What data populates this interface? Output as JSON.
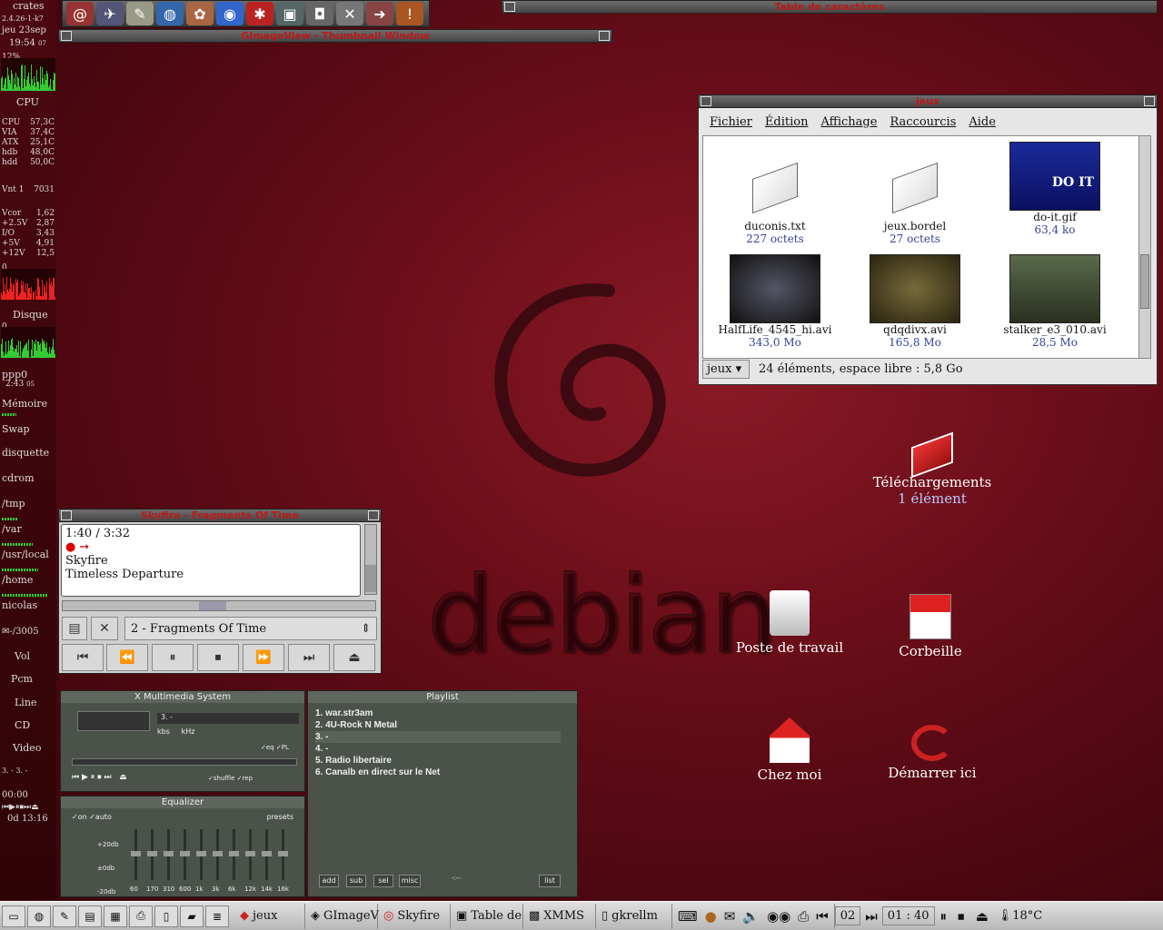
{
  "gkrellm": {
    "host": "crates",
    "kernel": "2.4.26-1-k7",
    "date": "jeu 23sep",
    "time": "19:54",
    "secs": "07",
    "cpu_pct": "12%",
    "cpu_label": "CPU",
    "sensors": [
      [
        "CPU",
        "57,3C"
      ],
      [
        "VIA",
        "37,4C"
      ],
      [
        "ATX",
        "25,1C"
      ],
      [
        "hdb",
        "48,0C"
      ],
      [
        "hdd",
        "50,0C"
      ]
    ],
    "fan": [
      "Vnt 1",
      "7031"
    ],
    "volts": [
      [
        "Vcor",
        "1,62"
      ],
      [
        "+2.5V",
        "2,87"
      ],
      [
        "I/O",
        "3,43"
      ],
      [
        "+5V",
        "4,91"
      ],
      [
        "+12V",
        "12,5"
      ]
    ],
    "zero1": "0",
    "disk_label": "Disque",
    "zero2": "0",
    "ppp_label": "ppp0",
    "ppp_time": "2:43",
    "ppp_secs": "05",
    "mem": "Mémoire",
    "swap": "Swap",
    "floppy": "disquette",
    "cdrom": "cdrom",
    "tmp": "/tmp",
    "var": "/var",
    "usrlocal": "/usr/local",
    "home": "/home",
    "user": "nicolas",
    "mail": "-/3005",
    "vol": "Vol",
    "pcm": "Pcm",
    "line": "Line",
    "cd": "CD",
    "video": "Video",
    "dashes": "3. - 3. -",
    "clock": "00:00",
    "uptime": "0d 13:16"
  },
  "windows": {
    "gimageview_title": "GImageView - Thumbnail Window",
    "charmap_title": "Table de caractères",
    "konq_title": "jeux",
    "sky_title": "Skyfire - Fragments Of Time"
  },
  "konq": {
    "menu": [
      "Fichier",
      "Édition",
      "Affichage",
      "Raccourcis",
      "Aide"
    ],
    "files": [
      {
        "name": "duconis.txt",
        "size": "227 octets"
      },
      {
        "name": "jeux.bordel",
        "size": "27 octets"
      },
      {
        "name": "do-it.gif",
        "size": "63,4 ko",
        "img_text": "DO IT"
      },
      {
        "name": "HalfLife_4545_hi.avi",
        "size": "343,0 Mo"
      },
      {
        "name": "qdqdivx.avi",
        "size": "165,8 Mo"
      },
      {
        "name": "stalker_e3_010.avi",
        "size": "28,5 Mo"
      }
    ],
    "location": "jeux",
    "status": "24 éléments, espace libre : 5,8 Go"
  },
  "desktop": {
    "downloads": "Téléchargements",
    "downloads_sub": "1 élément",
    "workstation": "Poste de travail",
    "trash": "Corbeille",
    "home": "Chez moi",
    "start": "Démarrer ici",
    "logo": "debian"
  },
  "player": {
    "time": "1:40 / 3:32",
    "artist": "Skyfire",
    "track": "Timeless Departure",
    "selected": "2 - Fragments Of Time"
  },
  "xmms": {
    "main_title": "X Multimedia System",
    "eq_title": "Equalizer",
    "pl_title": "Playlist",
    "playlist": [
      "1. war.str3am",
      "2. 4U-Rock N Metal",
      "3. -",
      "4. -",
      "5. Radio libertaire",
      "6. Canalb en direct sur le Net"
    ],
    "pl_buttons": [
      "add",
      "sub",
      "sel",
      "misc",
      "list"
    ],
    "eq_opts": [
      "on",
      "auto",
      "presets"
    ],
    "eq_db": [
      "+20db",
      "±0db",
      "-20db"
    ],
    "eq_bands": [
      "60",
      "170",
      "310",
      "600",
      "1k",
      "3k",
      "6k",
      "12k",
      "14k",
      "16k"
    ],
    "main_opts": [
      "kbs",
      "kHz",
      "eq",
      "PL",
      "shuffle",
      "rep"
    ],
    "display_text": "3. -",
    "pl_time": "-:--"
  },
  "taskbar": {
    "tasks": [
      "jeux",
      "GImageV",
      "Skyfire",
      "Table de",
      "XMMS",
      "gkrellm"
    ],
    "track_num": "02",
    "track_time": "01 : 40",
    "temp": "18°C"
  }
}
